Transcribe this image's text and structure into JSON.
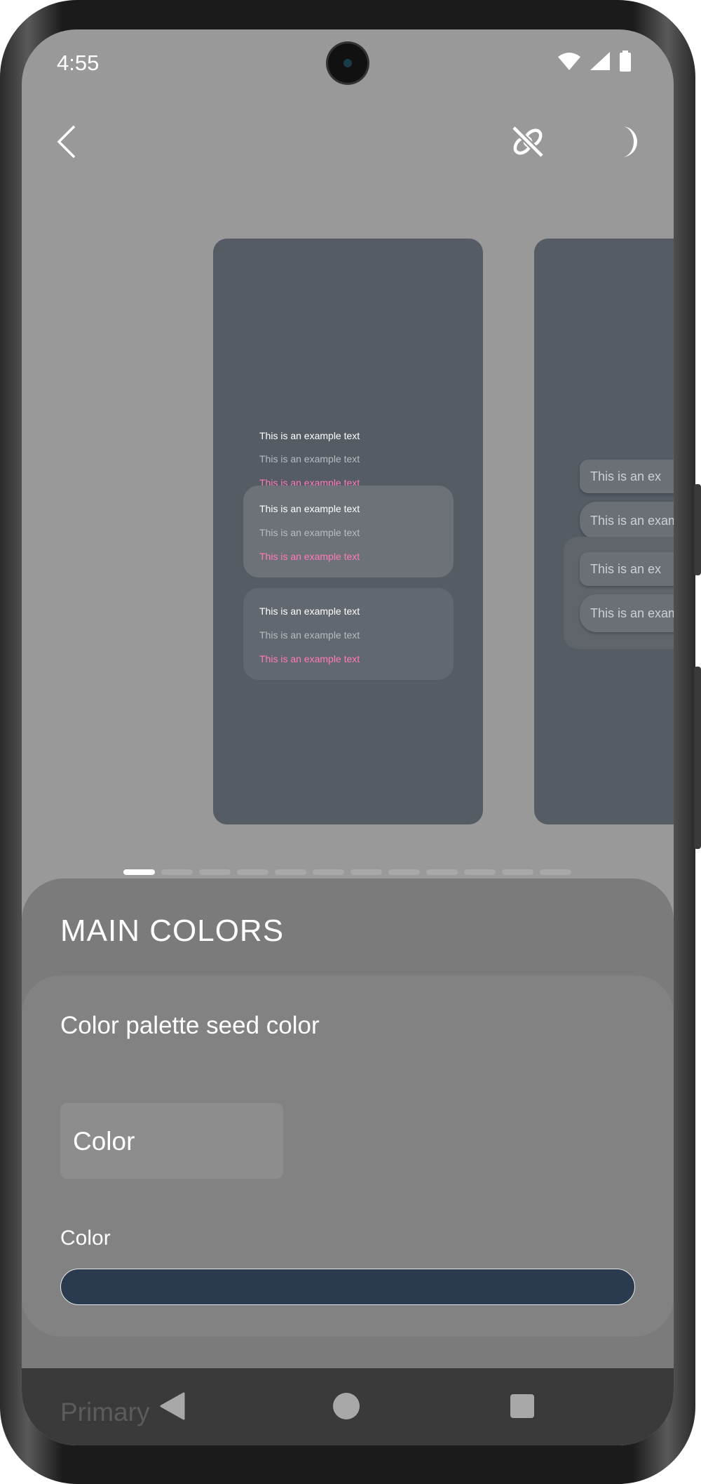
{
  "status_bar": {
    "time": "4:55",
    "icons": [
      "wifi-icon",
      "signal-icon",
      "battery-icon"
    ]
  },
  "top_bar": {
    "back_icon": "chevron-left-icon",
    "actions": [
      "link-off-icon",
      "moon-icon"
    ]
  },
  "preview": {
    "example_text": "This is an example text",
    "truncated_texts": [
      "This is an ex",
      "This is an exam",
      "This is an ex",
      "This is an exam"
    ],
    "page_count": 12,
    "active_page": 1
  },
  "sheet": {
    "title": "MAIN COLORS",
    "section": {
      "title": "Color palette seed color",
      "color_button": "Color",
      "color_label": "Color",
      "color_value": "#2b3b4f"
    },
    "next_label": "Primary"
  },
  "colors": {
    "screen_bg": "#999999",
    "card_bg": "#555c64",
    "accent_pink": "#ff7ab6",
    "seed": "#2b3b4f"
  },
  "nav_bar": [
    "back-icon",
    "home-icon",
    "recents-icon"
  ]
}
